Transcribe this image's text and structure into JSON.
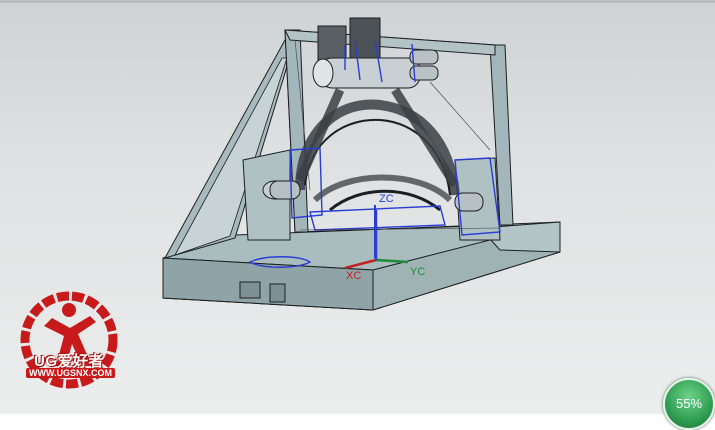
{
  "viewport": {
    "background_top": "#cfd2d4",
    "background_bottom": "#eceeee",
    "model_color": "#9fb3b5",
    "edge_color": "#1c1f22",
    "highlight_color": "#2a3cd6"
  },
  "axes": {
    "zc_label": "ZC",
    "xc_label": "XC",
    "yc_label": "YC",
    "x_color": "#c02222",
    "y_color": "#1e8a3a",
    "z_color": "#2a3cd6"
  },
  "watermark": {
    "title": "UG爱好者",
    "url": "WWW.UGSNX.COM",
    "color": "#c81a1a"
  },
  "zoom_indicator": {
    "value": "55%",
    "color": "#2f9e52"
  }
}
